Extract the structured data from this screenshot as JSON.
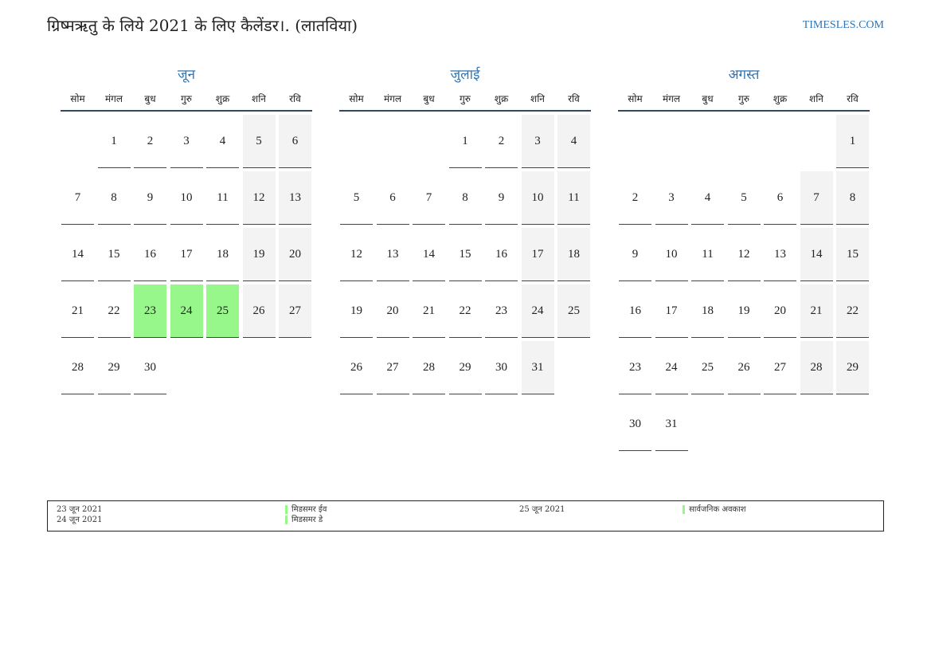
{
  "header": {
    "title": "ग्रिष्मऋतु के लिये 2021 के लिए कैलेंडर।. (लातविया)",
    "site": "TIMESLES.COM"
  },
  "weekdays": [
    "सोम",
    "मंगल",
    "बुध",
    "गुरु",
    "शुक्र",
    "शनि",
    "रवि"
  ],
  "colors": {
    "accent": "#2e75b6",
    "holiday": "#98f78a",
    "weekend": "#f3f3f3"
  },
  "months": [
    {
      "name": "जून",
      "weeks": [
        [
          "",
          "1",
          "2",
          "3",
          "4",
          "5",
          "6"
        ],
        [
          "7",
          "8",
          "9",
          "10",
          "11",
          "12",
          "13"
        ],
        [
          "14",
          "15",
          "16",
          "17",
          "18",
          "19",
          "20"
        ],
        [
          "21",
          "22",
          "23",
          "24",
          "25",
          "26",
          "27"
        ],
        [
          "28",
          "29",
          "30",
          "",
          "",
          "",
          ""
        ]
      ],
      "holidays": [
        "23",
        "24",
        "25"
      ]
    },
    {
      "name": "जुलाई",
      "weeks": [
        [
          "",
          "",
          "",
          "1",
          "2",
          "3",
          "4"
        ],
        [
          "5",
          "6",
          "7",
          "8",
          "9",
          "10",
          "11"
        ],
        [
          "12",
          "13",
          "14",
          "15",
          "16",
          "17",
          "18"
        ],
        [
          "19",
          "20",
          "21",
          "22",
          "23",
          "24",
          "25"
        ],
        [
          "26",
          "27",
          "28",
          "29",
          "30",
          "31",
          ""
        ]
      ],
      "holidays": []
    },
    {
      "name": "अगस्त",
      "weeks": [
        [
          "",
          "",
          "",
          "",
          "",
          "",
          "1"
        ],
        [
          "2",
          "3",
          "4",
          "5",
          "6",
          "7",
          "8"
        ],
        [
          "9",
          "10",
          "11",
          "12",
          "13",
          "14",
          "15"
        ],
        [
          "16",
          "17",
          "18",
          "19",
          "20",
          "21",
          "22"
        ],
        [
          "23",
          "24",
          "25",
          "26",
          "27",
          "28",
          "29"
        ],
        [
          "30",
          "31",
          "",
          "",
          "",
          "",
          ""
        ]
      ],
      "holidays": []
    }
  ],
  "legend": [
    {
      "date": "23 जून 2021",
      "label": "मिडसमर ईव"
    },
    {
      "date": "24 जून 2021",
      "label": "मिडसमर डे"
    },
    {
      "date": "25 जून 2021",
      "label": "सार्वजनिक अवकाश"
    }
  ]
}
